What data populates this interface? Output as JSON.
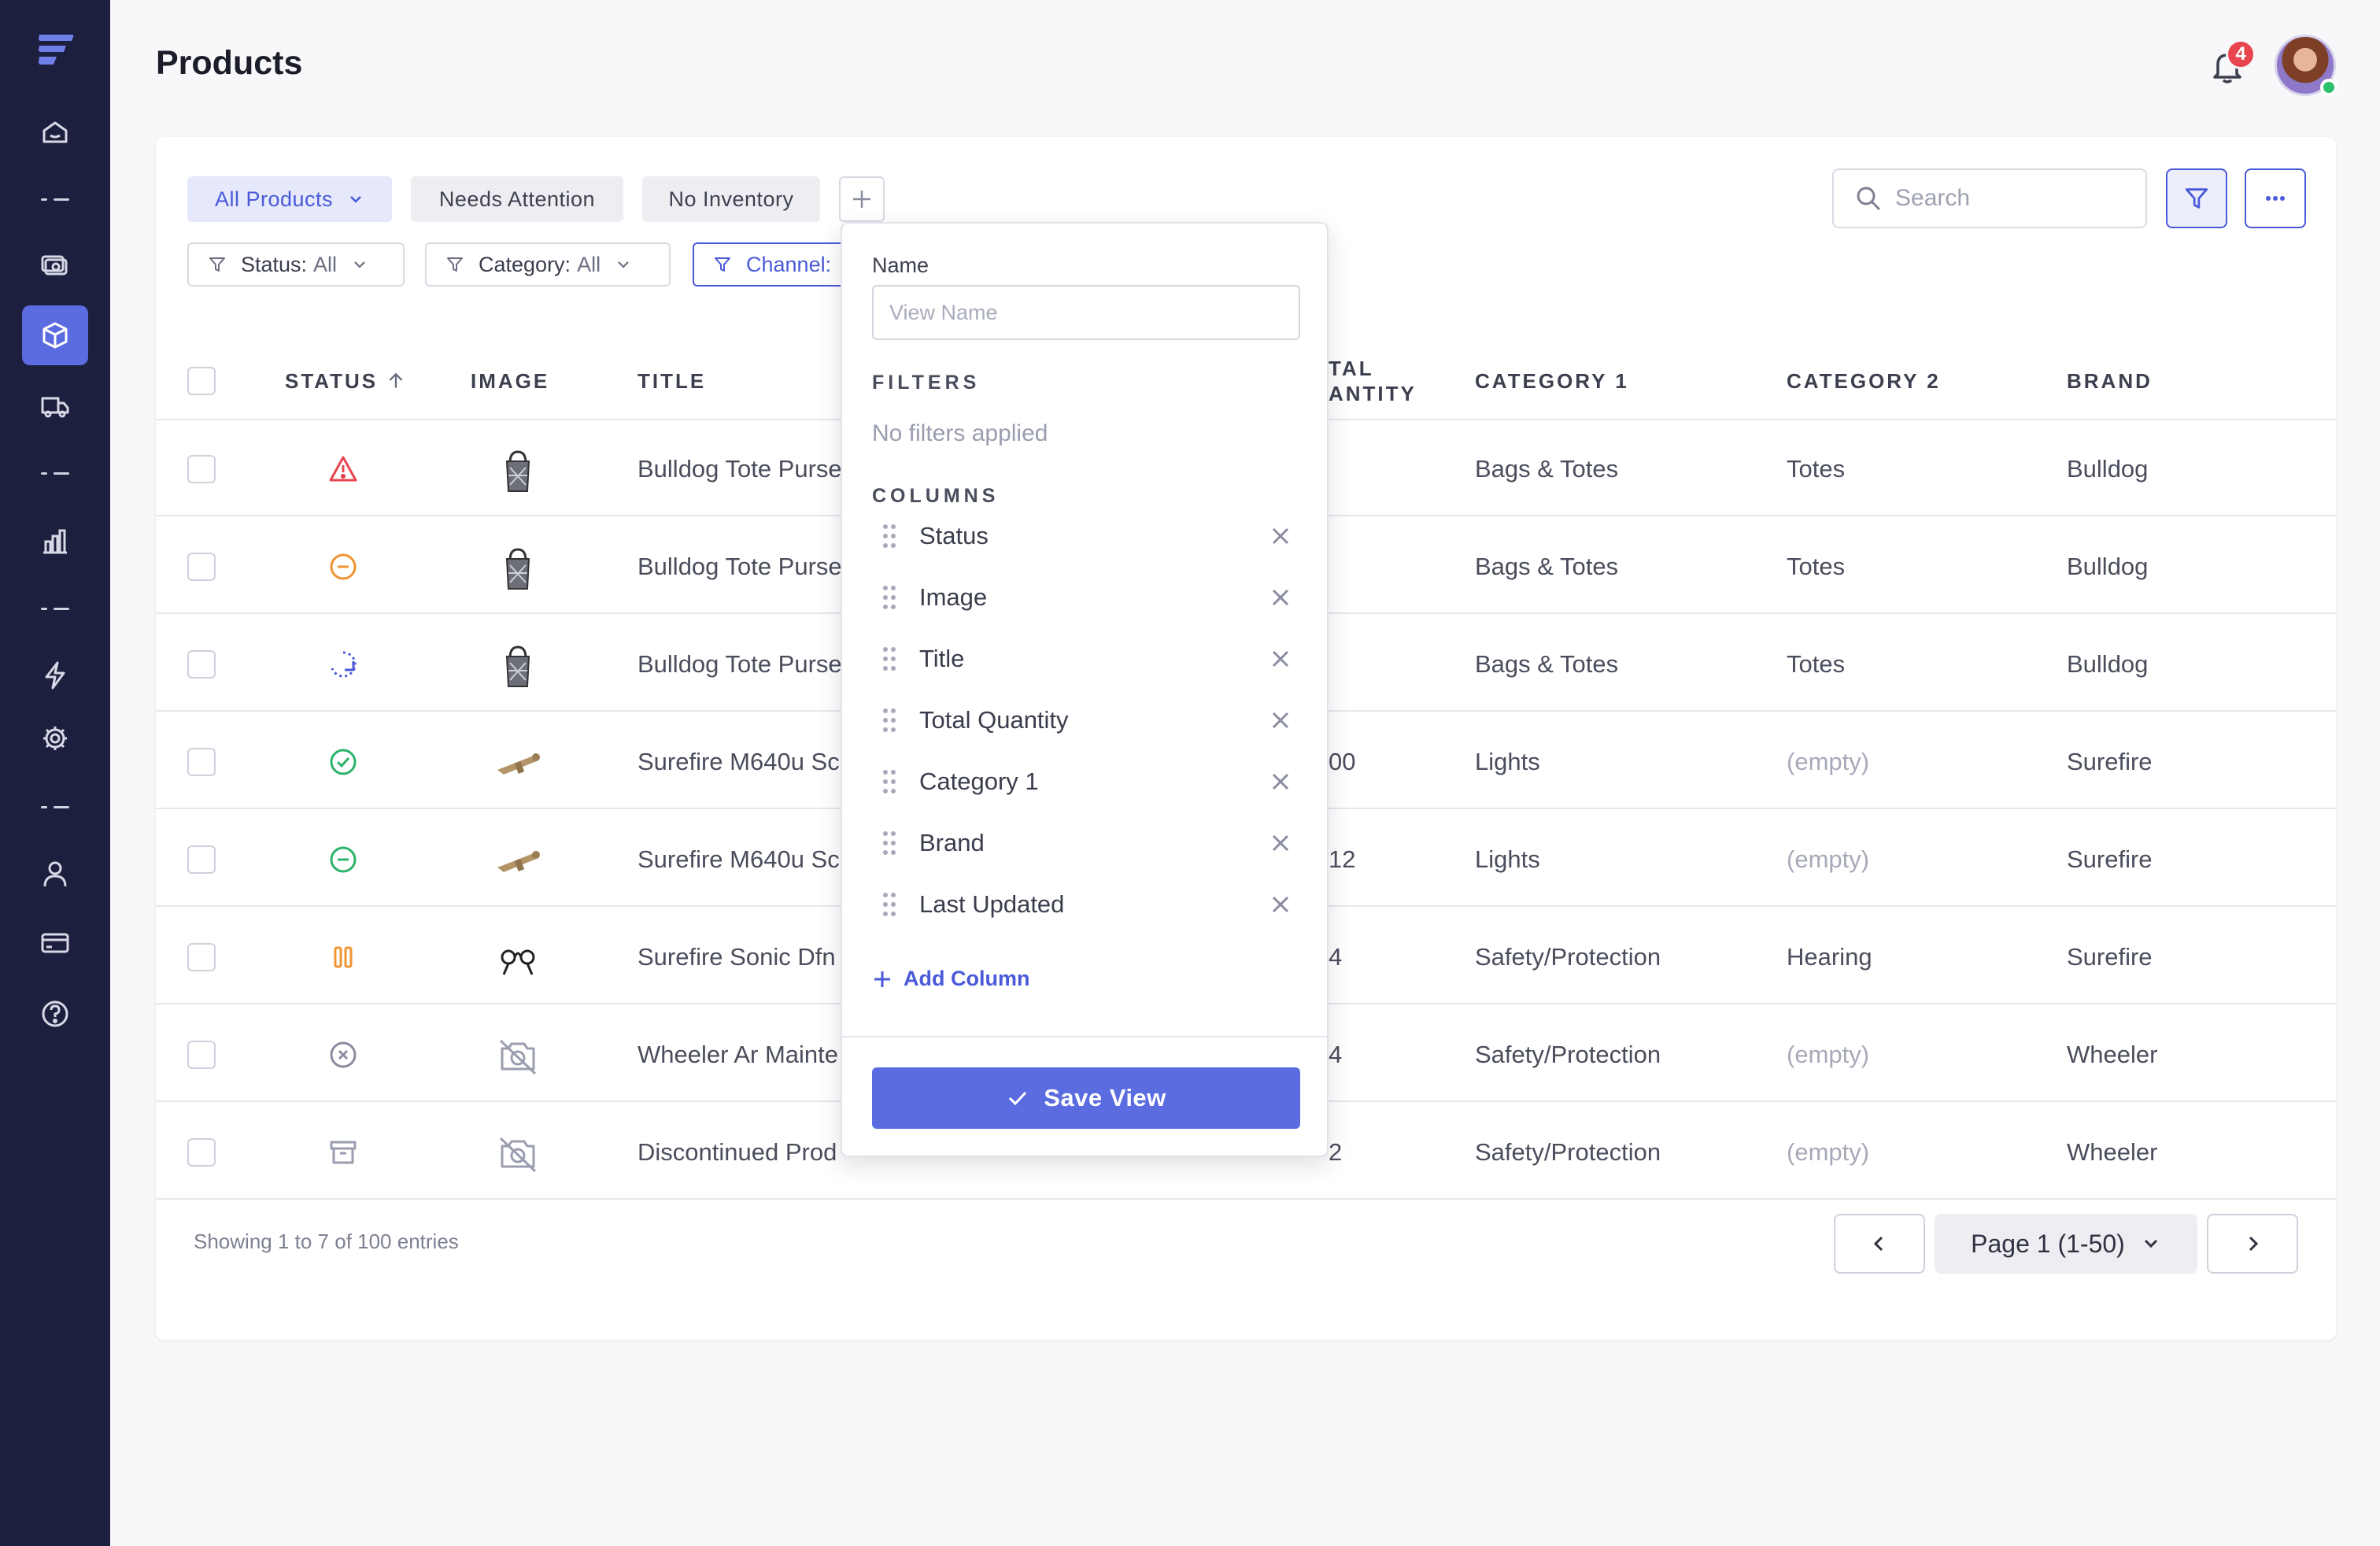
{
  "page": {
    "title": "Products"
  },
  "header": {
    "notifications_count": "4"
  },
  "sidebar": {
    "items": [
      {
        "icon": "home-icon",
        "active": false
      },
      {
        "icon": "cash-icon",
        "active": false
      },
      {
        "icon": "box-icon",
        "active": true
      },
      {
        "icon": "truck-icon",
        "active": false
      },
      {
        "icon": "bar-chart-icon",
        "active": false
      },
      {
        "icon": "lightning-icon",
        "active": false
      },
      {
        "icon": "gear-icon",
        "active": false
      },
      {
        "icon": "user-icon",
        "active": false
      },
      {
        "icon": "credit-card-icon",
        "active": false
      },
      {
        "icon": "help-icon",
        "active": false
      }
    ]
  },
  "views": {
    "tabs": [
      "All Products",
      "Needs Attention",
      "No Inventory"
    ],
    "active": "All Products"
  },
  "filters": [
    {
      "label": "Status:",
      "value": "All"
    },
    {
      "label": "Category:",
      "value": "All"
    },
    {
      "label": "Channel:",
      "value": ""
    }
  ],
  "search": {
    "placeholder": "Search"
  },
  "table": {
    "headers": {
      "status": "STATUS",
      "image": "IMAGE",
      "title": "TITLE",
      "total_quantity_line1": "TAL",
      "total_quantity_line2": "ANTITY",
      "category1": "CATEGORY 1",
      "category2": "CATEGORY 2",
      "brand": "BRAND"
    },
    "rows": [
      {
        "status": "warning",
        "image": "tote",
        "title": "Bulldog Tote Purse",
        "qty": "",
        "cat1": "Bags & Totes",
        "cat2": "Totes",
        "brand": "Bulldog"
      },
      {
        "status": "minus-orange",
        "image": "tote",
        "title": "Bulldog Tote Purse",
        "qty": "",
        "cat1": "Bags & Totes",
        "cat2": "Totes",
        "brand": "Bulldog"
      },
      {
        "status": "syncing",
        "image": "tote",
        "title": "Bulldog Tote Purse",
        "qty": "",
        "cat1": "Bags & Totes",
        "cat2": "Totes",
        "brand": "Bulldog"
      },
      {
        "status": "active",
        "image": "light",
        "title": "Surefire M640u Sc",
        "qty": "00",
        "cat1": "Lights",
        "cat2": "(empty)",
        "brand": "Surefire"
      },
      {
        "status": "minus-green",
        "image": "light",
        "title": "Surefire M640u Sc",
        "qty": "12",
        "cat1": "Lights",
        "cat2": "(empty)",
        "brand": "Surefire"
      },
      {
        "status": "paused",
        "image": "earplugs",
        "title": "Surefire Sonic Dfn",
        "qty": "4",
        "cat1": "Safety/Protection",
        "cat2": "Hearing",
        "brand": "Surefire"
      },
      {
        "status": "inactive",
        "image": "none",
        "title": "Wheeler Ar Mainte",
        "qty": "4",
        "cat1": "Safety/Protection",
        "cat2": "(empty)",
        "brand": "Wheeler"
      },
      {
        "status": "archived",
        "image": "none",
        "title": "Discontinued Prod",
        "qty": "2",
        "cat1": "Safety/Protection",
        "cat2": "(empty)",
        "brand": "Wheeler"
      }
    ]
  },
  "footer": {
    "showing": "Showing 1 to 7 of 100 entries",
    "page_label": "Page 1 (1-50)"
  },
  "popover": {
    "name_label": "Name",
    "name_placeholder": "View Name",
    "filters_heading": "FILTERS",
    "filters_empty": "No filters applied",
    "columns_heading": "COLUMNS",
    "columns": [
      "Status",
      "Image",
      "Title",
      "Total Quantity",
      "Category 1",
      "Brand",
      "Last Updated"
    ],
    "add_column": "Add Column",
    "save": "Save View"
  },
  "colors": {
    "sidebar_bg": "#1c1f3d",
    "accent": "#5b6be0",
    "link": "#4a5ad8",
    "danger": "#e8454e",
    "warning_orange": "#f09433",
    "success_green": "#2cb36b"
  }
}
